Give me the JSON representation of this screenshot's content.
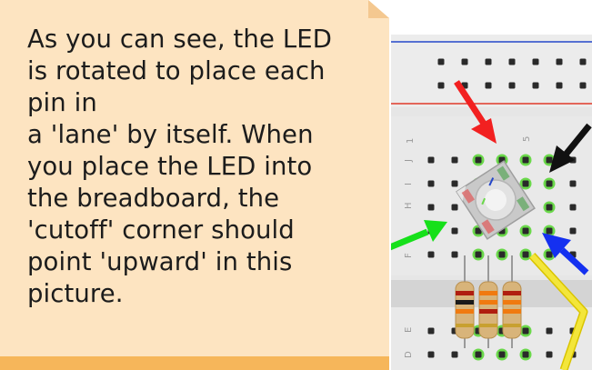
{
  "callout": {
    "text": "As you can see, the LED\nis rotated to place each\npin in\na 'lane' by itself. When\nyou place the LED into\nthe breadboard, the\n'cutoff' corner should\npoint 'upward' in this\npicture."
  },
  "breadboard": {
    "column_labels": [
      "1",
      "5"
    ],
    "row_labels_top": [
      "J",
      "I",
      "H",
      "F"
    ],
    "row_labels_bottom": [
      "E",
      "D"
    ]
  },
  "colors": {
    "callout_bg": "#fde4c1",
    "callout_bottom_band": "#f6b65a",
    "board_bg": "#e8e8e8",
    "rail_red": "#e03a2a",
    "rail_blue": "#2547c9",
    "green_hole": "#6ad84a",
    "arrow_red": "#f22020",
    "arrow_black": "#111111",
    "arrow_green": "#16e01a",
    "arrow_blue": "#1430f0",
    "wire_yellow": "#f0e020"
  },
  "icons": [
    "arrow-red-icon",
    "arrow-black-icon",
    "arrow-green-icon",
    "arrow-blue-icon"
  ]
}
